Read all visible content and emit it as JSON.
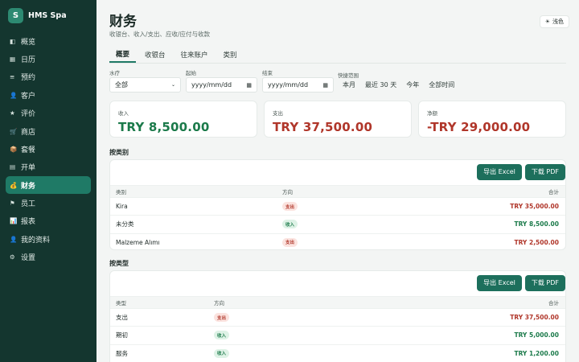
{
  "brand": {
    "logo_letter": "S",
    "name": "HMS Spa"
  },
  "sidebar": {
    "items": [
      {
        "icon": "◧",
        "icon_name": "overview-icon",
        "label": "概览",
        "active": false
      },
      {
        "icon": "▦",
        "icon_name": "calendar-icon",
        "label": "日历",
        "active": false
      },
      {
        "icon": "≡",
        "icon_name": "list-icon",
        "label": "预约",
        "active": false
      },
      {
        "icon": "👤",
        "icon_name": "customer-icon",
        "label": "客户",
        "active": false
      },
      {
        "icon": "★",
        "icon_name": "star-icon",
        "label": "评价",
        "active": false
      },
      {
        "icon": "🛒",
        "icon_name": "cart-icon",
        "label": "商店",
        "active": false
      },
      {
        "icon": "📦",
        "icon_name": "package-icon",
        "label": "套餐",
        "active": false
      },
      {
        "icon": "▤",
        "icon_name": "order-icon",
        "label": "开单",
        "active": false
      },
      {
        "icon": "💰",
        "icon_name": "money-bag-icon",
        "label": "财务",
        "active": true
      },
      {
        "icon": "⚑",
        "icon_name": "flag-icon",
        "label": "员工",
        "active": false
      },
      {
        "icon": "📊",
        "icon_name": "report-icon",
        "label": "报表",
        "active": false
      },
      {
        "icon": "👤",
        "icon_name": "profile-icon",
        "label": "我的资料",
        "active": false
      },
      {
        "icon": "⚙",
        "icon_name": "gear-icon",
        "label": "设置",
        "active": false
      }
    ]
  },
  "header": {
    "title": "财务",
    "subtitle": "收银台、收入/支出、应收/应付与收款",
    "theme_button": {
      "icon": "☀",
      "label": "浅色"
    }
  },
  "tabs": [
    {
      "label": "概要",
      "active": true
    },
    {
      "label": "收银台",
      "active": false
    },
    {
      "label": "往来账户",
      "active": false
    },
    {
      "label": "类别",
      "active": false
    }
  ],
  "filters": {
    "direction": {
      "label": "水疗",
      "value": "全部"
    },
    "start": {
      "label": "起始",
      "value": "yyyy/mm/dd"
    },
    "end": {
      "label": "结束",
      "value": "yyyy/mm/dd"
    },
    "quick": {
      "label": "快捷范围",
      "options": [
        "本月",
        "最近 30 天",
        "今年",
        "全部时间"
      ]
    }
  },
  "summary": [
    {
      "label": "收入",
      "value": "TRY 8,500.00",
      "color": "#1b7a4a"
    },
    {
      "label": "支出",
      "value": "TRY 37,500.00",
      "color": "#b0362a"
    },
    {
      "label": "净额",
      "value": "-TRY 29,000.00",
      "color": "#b0362a"
    }
  ],
  "by_category": {
    "title": "按类别",
    "export_excel": "导出 Excel",
    "download_pdf": "下载 PDF",
    "columns": [
      "类别",
      "方向",
      "合计"
    ],
    "rows": [
      {
        "name": "Kira",
        "direction": "支出",
        "kind": "out",
        "total": "TRY 35,000.00"
      },
      {
        "name": "未分类",
        "direction": "收入",
        "kind": "in",
        "total": "TRY 8,500.00"
      },
      {
        "name": "Malzeme Alımı",
        "direction": "支出",
        "kind": "out",
        "total": "TRY 2,500.00"
      }
    ]
  },
  "by_type": {
    "title": "按类型",
    "export_excel": "导出 Excel",
    "download_pdf": "下载 PDF",
    "columns": [
      "类型",
      "方向",
      "合计"
    ],
    "rows": [
      {
        "name": "支出",
        "direction": "支出",
        "kind": "out",
        "total": "TRY 37,500.00"
      },
      {
        "name": "期初",
        "direction": "收入",
        "kind": "in",
        "total": "TRY 5,000.00"
      },
      {
        "name": "服务",
        "direction": "收入",
        "kind": "in",
        "total": "TRY 1,200.00"
      }
    ]
  }
}
